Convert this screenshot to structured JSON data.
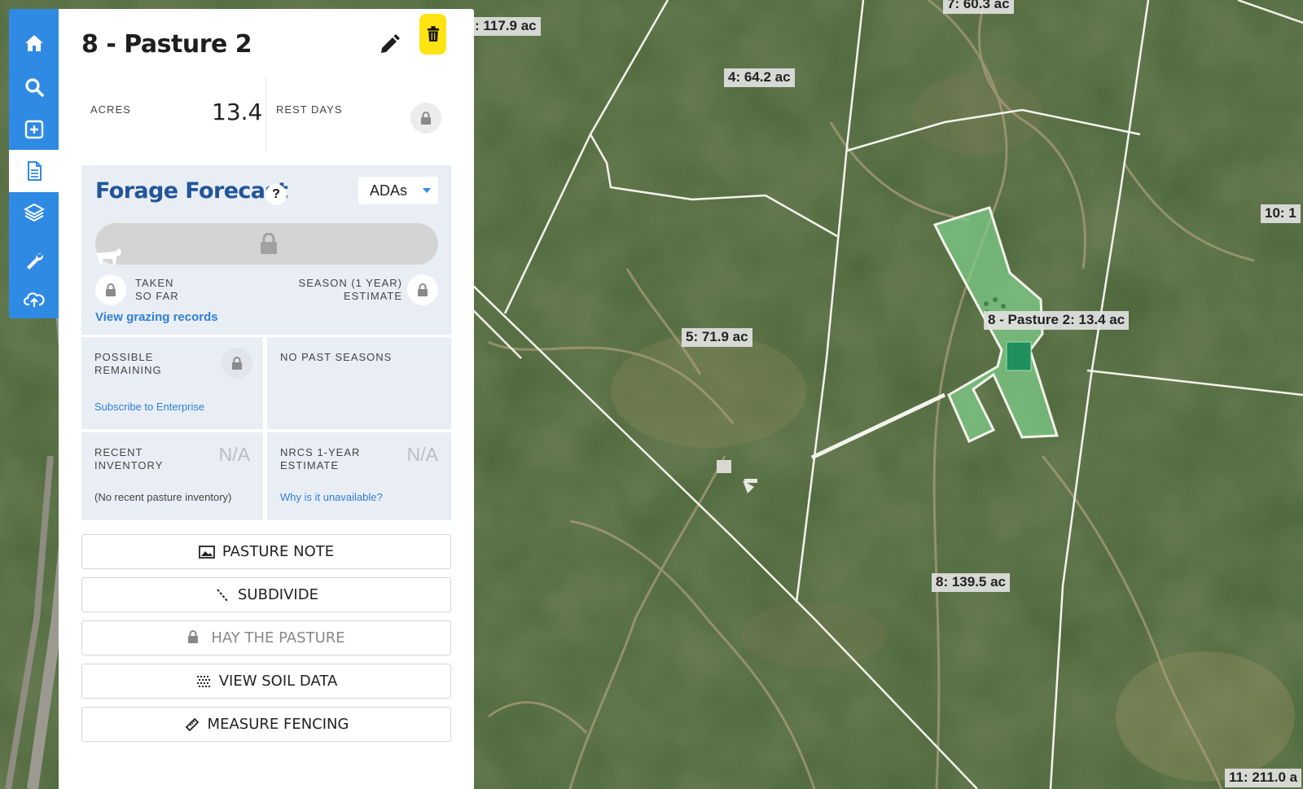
{
  "map": {
    "labels": [
      {
        "id": "p-117",
        "text": ": 117.9 ac"
      },
      {
        "id": "p-7",
        "text": "7: 60.3 ac"
      },
      {
        "id": "p-4",
        "text": "4: 64.2 ac"
      },
      {
        "id": "p-10",
        "text": "10: 1"
      },
      {
        "id": "p-5",
        "text": "5: 71.9 ac"
      },
      {
        "id": "p-selected",
        "text": "8 - Pasture 2: 13.4 ac"
      },
      {
        "id": "p-8",
        "text": "8: 139.5 ac"
      },
      {
        "id": "p-11",
        "text": "11: 211.0 a"
      }
    ],
    "colors": {
      "vegetation": "#3f5b2c",
      "boundary": "#f2f2ea",
      "selected_fill": "#7fd08a",
      "pond": "#1f8f5d"
    }
  },
  "nav": {
    "items": [
      {
        "name": "home",
        "icon": "home-icon"
      },
      {
        "name": "search",
        "icon": "search-icon"
      },
      {
        "name": "add",
        "icon": "add-square-icon"
      },
      {
        "name": "details",
        "icon": "document-icon",
        "active": true
      },
      {
        "name": "layers",
        "icon": "layers-icon"
      },
      {
        "name": "tools",
        "icon": "wrench-icon"
      },
      {
        "name": "sync",
        "icon": "cloud-sync-icon"
      }
    ],
    "accent": "#2f8ae4"
  },
  "panel": {
    "title": "8 - Pasture 2",
    "stats": {
      "acres_label": "ACRES",
      "acres_value": "13.4",
      "rest_label": "REST DAYS"
    },
    "forecast": {
      "title": "Forage Forecast",
      "help": "?",
      "unit": "ADAs",
      "taken_label_1": "TAKEN",
      "taken_label_2": "SO FAR",
      "season_label_1": "SEASON (1 YEAR)",
      "season_label_2": "ESTIMATE",
      "grazing_link": "View grazing records"
    },
    "cells": {
      "possible_1": "POSSIBLE",
      "possible_2": "REMAINING",
      "subscribe_link": "Subscribe to Enterprise",
      "past_seasons": "NO PAST SEASONS",
      "inventory_1": "RECENT",
      "inventory_2": "INVENTORY",
      "inventory_value": "N/A",
      "inventory_note": "(No recent pasture inventory)",
      "nrcs_1": "NRCS 1-YEAR",
      "nrcs_2": "ESTIMATE",
      "nrcs_value": "N/A",
      "nrcs_link": "Why is it unavailable?"
    },
    "actions": {
      "pasture_note": "PASTURE NOTE",
      "subdivide": "SUBDIVIDE",
      "hay": "HAY THE PASTURE",
      "soil": "VIEW SOIL DATA",
      "fencing": "MEASURE FENCING"
    },
    "colors": {
      "title_blue": "#23559a",
      "link_blue": "#2f7ed8",
      "delete_yellow": "#ffe313",
      "card_bg": "#e9eef5"
    }
  }
}
